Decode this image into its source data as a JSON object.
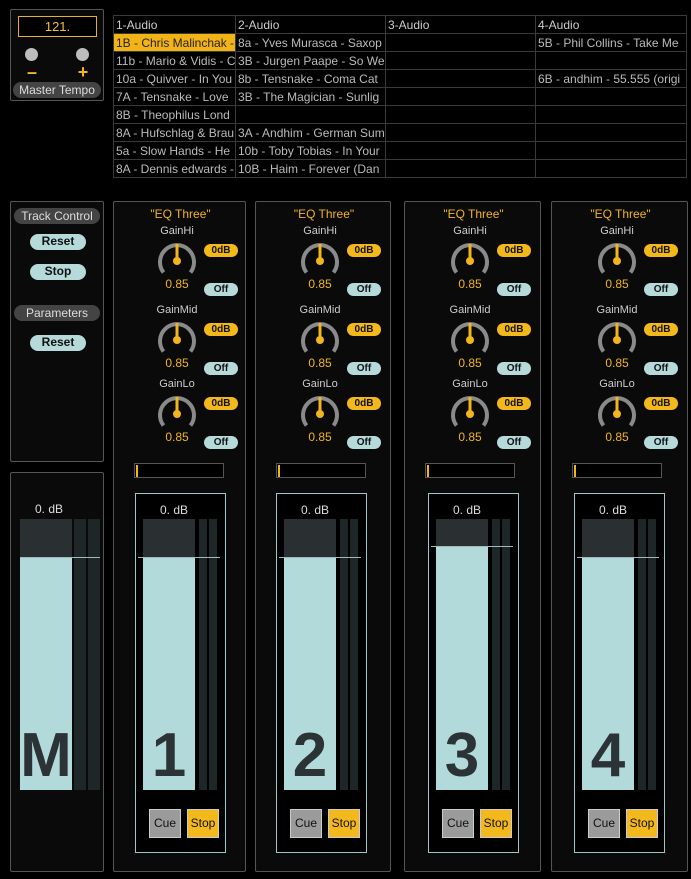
{
  "master_tempo": {
    "value": "121.",
    "minus": "–",
    "plus": "+",
    "label": "Master Tempo"
  },
  "clip_grid": {
    "headers": [
      "1-Audio",
      "2-Audio",
      "3-Audio",
      "4-Audio"
    ],
    "rows": [
      [
        "1B - Chris Malinchak - ",
        "8a - Yves Murasca - Saxop",
        "",
        "5B - Phil Collins - Take Me"
      ],
      [
        "11b - Mario & Vidis - C",
        "3B - Jurgen Paape - So We",
        "",
        ""
      ],
      [
        "10a - Quivver - In You",
        "8b - Tensnake - Coma Cat",
        "",
        "6B - andhim - 55.555 (origi"
      ],
      [
        "7A - Tensnake - Love",
        "3B - The Magician - Sunlig",
        "",
        ""
      ],
      [
        "8B - Theophilus Lond",
        "",
        "",
        ""
      ],
      [
        "8A - Hufschlag & Brau",
        "3A - Andhim - German Sum",
        "",
        ""
      ],
      [
        "5a - Slow Hands - He",
        "10b - Toby Tobias - In Your",
        "",
        ""
      ],
      [
        "8A - Dennis edwards -",
        "10B - Haim - Forever (Dan",
        "",
        ""
      ]
    ],
    "selected": "1B - Chris Malinchak - "
  },
  "track_control": {
    "title": "Track Control",
    "reset_label": "Reset",
    "stop_label": "Stop",
    "parameters_title": "Parameters",
    "parameters_reset_label": "Reset"
  },
  "master_channel": {
    "db": "0.  dB",
    "number": "M",
    "level": 0.86
  },
  "tracks": [
    {
      "eq_title": "\"EQ Three\"",
      "knobs": [
        {
          "name": "GainHi",
          "value": "0.85",
          "db": "0dB",
          "off": "Off"
        },
        {
          "name": "GainMid",
          "value": "0.85",
          "db": "0dB",
          "off": "Off"
        },
        {
          "name": "GainLo",
          "value": "0.85",
          "db": "0dB",
          "off": "Off"
        }
      ],
      "db": "0.  dB",
      "number": "1",
      "cue": "Cue",
      "stop": "Stop",
      "level": 0.86
    },
    {
      "eq_title": "\"EQ Three\"",
      "knobs": [
        {
          "name": "GainHi",
          "value": "0.85",
          "db": "0dB",
          "off": "Off"
        },
        {
          "name": "GainMid",
          "value": "0.85",
          "db": "0dB",
          "off": "Off"
        },
        {
          "name": "GainLo",
          "value": "0.85",
          "db": "0dB",
          "off": "Off"
        }
      ],
      "db": "0.  dB",
      "number": "2",
      "cue": "Cue",
      "stop": "Stop",
      "level": 0.86
    },
    {
      "eq_title": "\"EQ Three\"",
      "knobs": [
        {
          "name": "GainHi",
          "value": "0.85",
          "db": "0dB",
          "off": "Off"
        },
        {
          "name": "GainMid",
          "value": "0.85",
          "db": "0dB",
          "off": "Off"
        },
        {
          "name": "GainLo",
          "value": "0.85",
          "db": "0dB",
          "off": "Off"
        }
      ],
      "db": "0.  dB",
      "number": "3",
      "cue": "Cue",
      "stop": "Stop",
      "level": 0.9
    },
    {
      "eq_title": "\"EQ Three\"",
      "knobs": [
        {
          "name": "GainHi",
          "value": "0.85",
          "db": "0dB",
          "off": "Off"
        },
        {
          "name": "GainMid",
          "value": "0.85",
          "db": "0dB",
          "off": "Off"
        },
        {
          "name": "GainLo",
          "value": "0.85",
          "db": "0dB",
          "off": "Off"
        }
      ],
      "db": "0.  dB",
      "number": "4",
      "cue": "Cue",
      "stop": "Stop",
      "level": 0.86
    }
  ]
}
